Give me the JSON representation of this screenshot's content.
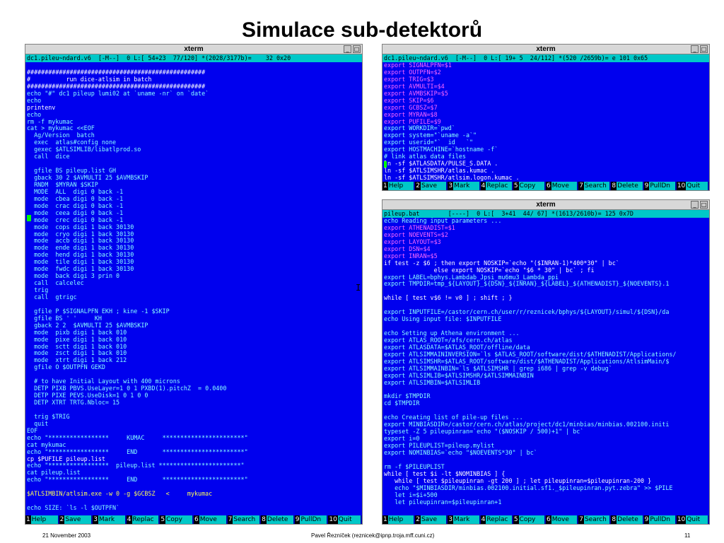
{
  "slide": {
    "title": "Simulace sub-detektorů",
    "footer_date": "21 November 2003",
    "footer_author": "Pavel Řezníček (reznicek@ipnp.troja.mff.cuni.cz)",
    "footer_page": "11"
  },
  "colors": {
    "terminal_bg": "#0000ee",
    "status_bg": "#00c8c8",
    "highlight_yellow": "#ffff55",
    "highlight_pink": "#ff66ff"
  },
  "window_buttons": {
    "minimize": "_",
    "maximize": "□"
  },
  "left_terminal": {
    "title": "xterm",
    "status": "dc1.pileu~ndard.v6  [-M--]  0 L:[ 54+23  77/120] *(2028/3177b)=    32 0x20",
    "lines": [
      {
        "t": "",
        "k": "w"
      },
      {
        "t": "##################################################",
        "k": "w"
      },
      {
        "t": "#          run dice-atlsim in batch",
        "k": "w"
      },
      {
        "t": "##################################################",
        "k": "w"
      },
      {
        "t": "echo \"#\" dc1 pileup lumi02 at `uname -nr` on `date`",
        "k": "c"
      },
      {
        "t": "echo",
        "k": "c"
      },
      {
        "t": "printenv",
        "k": "w"
      },
      {
        "t": "echo",
        "k": "c"
      },
      {
        "t": "rm -f mykumac",
        "k": "c"
      },
      {
        "t": "cat > mykumac <<EOF",
        "k": "c"
      },
      {
        "t": "  Ag/Version  batch",
        "k": "c"
      },
      {
        "t": "  exec  atlas#config none",
        "k": "c"
      },
      {
        "t": "  gexec $ATLSIMLIB/libatlprod.so",
        "k": "c"
      },
      {
        "t": "  call  dice",
        "k": "c"
      },
      {
        "t": "",
        "k": "w"
      },
      {
        "t": "  gfile BS pileup.list GH",
        "k": "c"
      },
      {
        "t": "  gback 30 2 $AVMULTI 25 $AVMBSKIP",
        "k": "c"
      },
      {
        "t": "  RNDM  $MYRAN $SKIP",
        "k": "c"
      },
      {
        "t": "  MODE  ALL  digi 0 back -1",
        "k": "c"
      },
      {
        "t": "  mode  cbea digi 0 back -1",
        "k": "c"
      },
      {
        "t": "  mode  crac digi 0 back -1",
        "k": "c"
      },
      {
        "t": "  mode  ceea digi 0 back -1",
        "k": "c"
      },
      {
        "t": "  mode  crec digi 0 back -1",
        "k": "c"
      },
      {
        "t": "  mode  cops digi 1 back 30130",
        "k": "c"
      },
      {
        "t": "  mode  cryo digi 1 back 30130",
        "k": "c"
      },
      {
        "t": "  mode  accb digi 1 back 30130",
        "k": "c"
      },
      {
        "t": "  mode  ende digi 1 back 30130",
        "k": "c"
      },
      {
        "t": "  mode  hend digi 1 back 30130",
        "k": "c"
      },
      {
        "t": "  mode  tile digi 1 back 30130",
        "k": "c"
      },
      {
        "t": "  mode  fwdc digi 1 back 30130",
        "k": "c"
      },
      {
        "t": "  mode  back digi 3 prin 0",
        "k": "c"
      },
      {
        "t": "  call  calcelec",
        "k": "c"
      },
      {
        "t": "  trig",
        "k": "c"
      },
      {
        "t": "  call  gtrigc",
        "k": "c"
      },
      {
        "t": "",
        "k": "w"
      },
      {
        "t": "  gfile P $SIGNALPFN EKH ; kine -1 $SKIP",
        "k": "c"
      },
      {
        "t": "  gfile BS ' '     KH",
        "k": "c"
      },
      {
        "t": "  gback 2 2  $AVMULTI 25 $AVMBSKIP",
        "k": "c"
      },
      {
        "t": "  mode  pixb digi 1 back 010",
        "k": "c"
      },
      {
        "t": "  mode  pixe digi 1 back 010",
        "k": "c"
      },
      {
        "t": "  mode  sctt digi 1 back 010",
        "k": "c"
      },
      {
        "t": "  mode  zsct digi 1 back 010",
        "k": "c"
      },
      {
        "t": "  mode  xtrt digi 1 back 212",
        "k": "c"
      },
      {
        "t": "  gfile O $OUTPFN GEKD",
        "k": "c"
      },
      {
        "t": "",
        "k": "w"
      },
      {
        "t": "  # to have Initial Layout with 400 microns",
        "k": "c"
      },
      {
        "t": "  DETP PIXB PBVS.UseLayer=1 0 1 PXBD(1).pitchZ  = 0.0400",
        "k": "c"
      },
      {
        "t": "  DETP PIXE PEVS.UseDisk=1 0 1 0 0",
        "k": "c"
      },
      {
        "t": "  DETP XTRT TRTG.Nbloc= 15",
        "k": "c"
      },
      {
        "t": "",
        "k": "w"
      },
      {
        "t": "  trig $TRIG",
        "k": "c"
      },
      {
        "t": "  quit",
        "k": "c"
      },
      {
        "t": "EOF",
        "k": "c"
      },
      {
        "t": "echo \"*****************     KUMAC     ***********************\"",
        "k": "c"
      },
      {
        "t": "cat mykumac",
        "k": "c"
      },
      {
        "t": "echo \"*****************     END       ***********************\"",
        "k": "c"
      },
      {
        "t": "cp $PUFILE pileup.list",
        "k": "w"
      },
      {
        "t": "echo \"*****************  pileup.list ***********************\"",
        "k": "c"
      },
      {
        "t": "cat pileup.list",
        "k": "c"
      },
      {
        "t": "echo \"*****************     END       ***********************\"",
        "k": "c"
      },
      {
        "t": "",
        "k": "w"
      },
      {
        "t": "$ATLSIMBIN/atlsim.exe -w 0 -g $GCBSZ   <     mykumac",
        "k": "y"
      },
      {
        "t": "",
        "k": "w"
      },
      {
        "t": "echo SIZE: `ls -l $OUTPFN`",
        "k": "c"
      }
    ],
    "fnkeys": [
      {
        "n": "1",
        "l": "Help"
      },
      {
        "n": "2",
        "l": "Save"
      },
      {
        "n": "3",
        "l": "Mark"
      },
      {
        "n": "4",
        "l": "Replac"
      },
      {
        "n": "5",
        "l": "Copy"
      },
      {
        "n": "6",
        "l": "Move"
      },
      {
        "n": "7",
        "l": "Search"
      },
      {
        "n": "8",
        "l": "Delete"
      },
      {
        "n": "9",
        "l": "PullDn"
      },
      {
        "n": "10",
        "l": "Quit"
      }
    ]
  },
  "top_right_terminal": {
    "title": "xterm",
    "status": "dc1.pileu~ndard.v6  [-M--]  0 L:[ 19+ 5  24/112] *(520 /2659b)= e 101 0x65",
    "lines": [
      {
        "t": "export SIGNALPFN=$1",
        "k": "p"
      },
      {
        "t": "export OUTPFN=$2",
        "k": "p"
      },
      {
        "t": "export TRIG=$3",
        "k": "p"
      },
      {
        "t": "export AVMULTI=$4",
        "k": "p"
      },
      {
        "t": "export AVMBSKIP=$5",
        "k": "p"
      },
      {
        "t": "export SKIP=$6",
        "k": "p"
      },
      {
        "t": "export GCBSZ=$7",
        "k": "p"
      },
      {
        "t": "export MYRAN=$8",
        "k": "p"
      },
      {
        "t": "export PUFILE=$9",
        "k": "p"
      },
      {
        "t": "export WORKDIR=`pwd`",
        "k": "c"
      },
      {
        "t": "export system=\"`uname -a`\"",
        "k": "c"
      },
      {
        "t": "export userid=\"`  id   `\"",
        "k": "c"
      },
      {
        "t": "export HOSTMACHINE=`hostname -f`",
        "k": "c"
      },
      {
        "t": "# link atlas data files",
        "k": "c"
      },
      {
        "t": "ln -sf $ATLASDATA/PULSE_S.DATA .",
        "k": "w"
      },
      {
        "t": "ln -sf $ATLSIMSHR/atlas.kumac .",
        "k": "w"
      },
      {
        "t": "ln -sf $ATLSIMSHR/atlsim.logon.kumac .",
        "k": "w"
      }
    ],
    "fnkeys": [
      {
        "n": "1",
        "l": "Help"
      },
      {
        "n": "2",
        "l": "Save"
      },
      {
        "n": "3",
        "l": "Mark"
      },
      {
        "n": "4",
        "l": "Replac"
      },
      {
        "n": "5",
        "l": "Copy"
      },
      {
        "n": "6",
        "l": "Move"
      },
      {
        "n": "7",
        "l": "Search"
      },
      {
        "n": "8",
        "l": "Delete"
      },
      {
        "n": "9",
        "l": "PullDn"
      },
      {
        "n": "10",
        "l": "Quit"
      }
    ]
  },
  "bottom_right_terminal": {
    "title": "xterm",
    "status": "pileup.bat        [----]  0 L:[  3+41  44/ 67] *(1613/2610b)= 125 0x7D",
    "lines": [
      {
        "t": "echo Reading input parameters ...",
        "k": "c"
      },
      {
        "t": "export ATHENADIST=$1",
        "k": "p"
      },
      {
        "t": "export NOEVENTS=$2",
        "k": "p"
      },
      {
        "t": "export LAYOUT=$3",
        "k": "p"
      },
      {
        "t": "export DSN=$4",
        "k": "p"
      },
      {
        "t": "export INRAN=$5",
        "k": "p"
      },
      {
        "t": "if test -z $6 ; then export NOSKIP=`echo \"($INRAN-1)*400*30\" | bc`",
        "k": "w"
      },
      {
        "t": "              else export NOSKIP=`echo \"$6 * 30\" | bc` ; fi",
        "k": "w"
      },
      {
        "t": "export LABEL=bphys.Lambdab_Jpsi_mu6mu3_Lambda_ppi",
        "k": "c"
      },
      {
        "t": "export TMPDIR=tmp_${LAYOUT}_${DSN}_${INRAN}_${LABEL}_${ATHENADIST}_${NOEVENTS}.1",
        "k": "c"
      },
      {
        "t": "",
        "k": "w"
      },
      {
        "t": "while [ test v$6 != v0 ] ; shift ; }",
        "k": "w"
      },
      {
        "t": "",
        "k": "w"
      },
      {
        "t": "export INPUTFILE=/castor/cern.ch/user/r/reznicek/bphys/${LAYOUT}/simul/${DSN}/da",
        "k": "c"
      },
      {
        "t": "echo Using input file: $INPUTFILE",
        "k": "c"
      },
      {
        "t": "",
        "k": "w"
      },
      {
        "t": "echo Setting up Athena environment ...",
        "k": "c"
      },
      {
        "t": "export ATLAS_ROOT=/afs/cern.ch/atlas",
        "k": "c"
      },
      {
        "t": "export ATLASDATA=$ATLAS_ROOT/offline/data",
        "k": "c"
      },
      {
        "t": "export ATLSIMMAININVERSION=`ls $ATLAS_ROOT/software/dist/$ATHENADIST/Applications/",
        "k": "c"
      },
      {
        "t": "export ATLSIMSHR=$ATLAS_ROOT/software/dist/$ATHENADIST/Applications/AtlsimMain/$",
        "k": "c"
      },
      {
        "t": "export ATLSIMMAINBIN=`ls $ATLSIMSHR | grep i686 | grep -v debug`",
        "k": "c"
      },
      {
        "t": "export ATLSIMLIB=$ATLSIMSHR/$ATLSIMMAINBIN",
        "k": "c"
      },
      {
        "t": "export ATLSIMBIN=$ATLSIMLIB",
        "k": "c"
      },
      {
        "t": "",
        "k": "w"
      },
      {
        "t": "mkdir $TMPDIR",
        "k": "c"
      },
      {
        "t": "cd $TMPDIR",
        "k": "c"
      },
      {
        "t": "",
        "k": "w"
      },
      {
        "t": "echo Creating list of pile-up files ...",
        "k": "c"
      },
      {
        "t": "export MINBIASDIR=/castor/cern.ch/atlas/project/dc1/minbias/minbias.002100.initi",
        "k": "c"
      },
      {
        "t": "typeset -Z 5 pileupinran=`echo \"($NOSKIP / 500)+1\" | bc`",
        "k": "c"
      },
      {
        "t": "export i=0",
        "k": "c"
      },
      {
        "t": "export PILEUPLIST=pileup.mylist",
        "k": "c"
      },
      {
        "t": "export NOMINBIAS=`echo \"$NOEVENTS*30\" | bc`",
        "k": "c"
      },
      {
        "t": "",
        "k": "w"
      },
      {
        "t": "rm -f $PILEUPLIST",
        "k": "c"
      },
      {
        "t": "while [ test $i -lt $NOMINBIAS ] {",
        "k": "w"
      },
      {
        "t": "   while [ test $pileupinran -gt 200 ] ; let pileupinran=$pileupinran-200 }",
        "k": "w"
      },
      {
        "t": "   echo \"$MINBIASDIR/minbias.002100.initial.sf1._$pileupinran.pyt.zebra\" >> $PILE",
        "k": "c"
      },
      {
        "t": "   let i=$i+500",
        "k": "c"
      },
      {
        "t": "   let pileupinran=$pileupinran+1",
        "k": "c"
      }
    ],
    "fnkeys": [
      {
        "n": "1",
        "l": "Help"
      },
      {
        "n": "2",
        "l": "Save"
      },
      {
        "n": "3",
        "l": "Mark"
      },
      {
        "n": "4",
        "l": "Replac"
      },
      {
        "n": "5",
        "l": "Copy"
      },
      {
        "n": "6",
        "l": "Move"
      },
      {
        "n": "7",
        "l": "Search"
      },
      {
        "n": "8",
        "l": "Delete"
      },
      {
        "n": "9",
        "l": "PullDn"
      },
      {
        "n": "10",
        "l": "Quit"
      }
    ]
  }
}
